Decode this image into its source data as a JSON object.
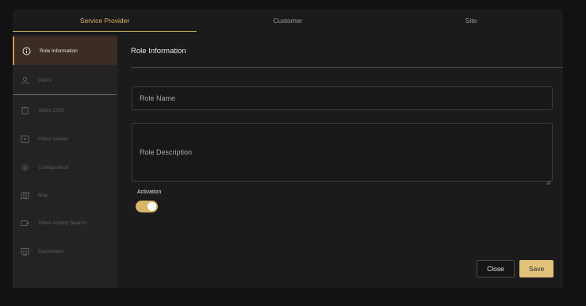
{
  "tabs": [
    {
      "label": "Service Provider",
      "active": true
    },
    {
      "label": "Customer",
      "active": false
    },
    {
      "label": "Site",
      "active": false
    }
  ],
  "sidebar": {
    "items": [
      {
        "label": "Role Information",
        "icon": "info-icon",
        "active": true
      },
      {
        "label": "Users",
        "icon": "user-icon",
        "active": false
      },
      {
        "label": "Tasks CMS",
        "icon": "clipboard-icon",
        "active": false
      },
      {
        "label": "Video Viewer",
        "icon": "play-icon",
        "active": false
      },
      {
        "label": "Configuration",
        "icon": "gear-icon",
        "active": false
      },
      {
        "label": "Map",
        "icon": "map-icon",
        "active": false
      },
      {
        "label": "Video Activity Search",
        "icon": "video-icon",
        "active": false
      },
      {
        "label": "Dashboard",
        "icon": "dashboard-icon",
        "active": false
      }
    ]
  },
  "main": {
    "title": "Role Information",
    "role_name_placeholder": "Role Name",
    "role_description_placeholder": "Role Description",
    "activation_label": "Activation",
    "activation_on": true
  },
  "actions": {
    "close_label": "Close",
    "save_label": "Save"
  },
  "colors": {
    "accent": "#d6b36a",
    "active_item_bg": "#3b2d24",
    "save_button": "#e1c27a"
  }
}
